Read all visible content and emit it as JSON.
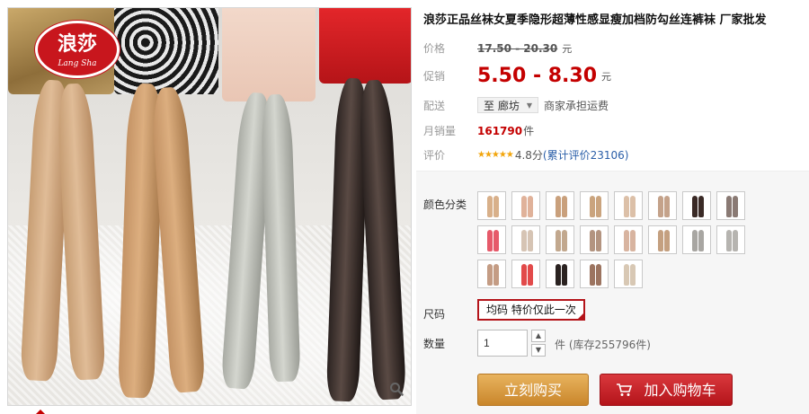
{
  "brand_logo": {
    "cn": "浪莎",
    "en": "Lang Sha"
  },
  "product": {
    "title": "浪莎正品丝袜女夏季隐形超薄性感显瘦加档防勾丝连裤袜 厂家批发"
  },
  "price": {
    "label": "价格",
    "value": "17.50 - 20.30",
    "unit": "元"
  },
  "promo": {
    "label": "促销",
    "value": "5.50 - 8.30",
    "unit": "元",
    "color": "#c40000"
  },
  "shipping": {
    "label": "配送",
    "destination": "至 廊坊",
    "note": "商家承担运费"
  },
  "sales": {
    "label": "月销量",
    "value": "161790",
    "unit": "件"
  },
  "rating": {
    "label": "评价",
    "score": "4.8分",
    "reviews": "(累计评价23106)",
    "stars": 5
  },
  "options": {
    "color_label": "颜色分类",
    "swatches": [
      {
        "leg": "#d8b08a"
      },
      {
        "leg": "#e0b29a"
      },
      {
        "leg": "#c9a07c"
      },
      {
        "leg": "#caa47e"
      },
      {
        "leg": "#dcc0a8"
      },
      {
        "leg": "#c4a28a"
      },
      {
        "leg": "#3a2a26"
      },
      {
        "leg": "#8a7a74"
      },
      {
        "leg": "#e65a6a"
      },
      {
        "leg": "#d6c4b4"
      },
      {
        "leg": "#c2a88e"
      },
      {
        "leg": "#b39480"
      },
      {
        "leg": "#d8b4a0"
      },
      {
        "leg": "#c4a080"
      },
      {
        "leg": "#a8a6a2"
      },
      {
        "leg": "#b6b4b0"
      },
      {
        "leg": "#c49c84"
      },
      {
        "leg": "#e24a4a"
      },
      {
        "leg": "#2a2220"
      },
      {
        "leg": "#9c7460"
      },
      {
        "leg": "#d8c8b4"
      }
    ],
    "size_label": "尺码",
    "size_value": "均码 特价仅此一次",
    "qty_label": "数量",
    "qty_value": "1",
    "stock_text": "件 (库存255796件)"
  },
  "actions": {
    "buy_label": "立刻购买",
    "cart_label": "加入购物车"
  },
  "icons": {
    "zoom": "magnifier-icon",
    "cart": "cart-icon",
    "caret": "caret-down-icon"
  }
}
